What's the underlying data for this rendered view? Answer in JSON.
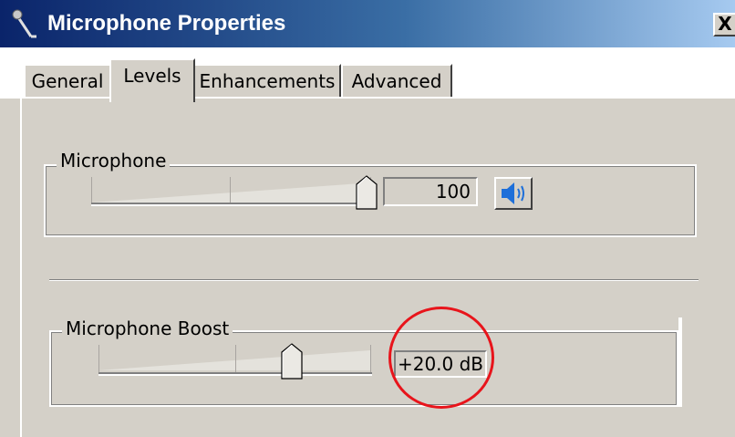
{
  "window": {
    "title": "Microphone Properties",
    "close_glyph": "X",
    "title_gradient": [
      "#0a246a",
      "#3a6ea5",
      "#a6caf0"
    ]
  },
  "tabs": [
    {
      "label": "General",
      "active": false
    },
    {
      "label": "Levels",
      "active": true
    },
    {
      "label": "Enhancements",
      "active": false
    },
    {
      "label": "Advanced",
      "active": false
    }
  ],
  "microphone": {
    "label": "Microphone",
    "value": "100",
    "slider_fraction": 1.0,
    "mute_icon": "speaker-icon"
  },
  "boost": {
    "label": "Microphone Boost",
    "value": "+20.0 dB",
    "slider_fraction": 0.667
  },
  "annotation": {
    "color": "#e8141b",
    "shape": "circle"
  }
}
